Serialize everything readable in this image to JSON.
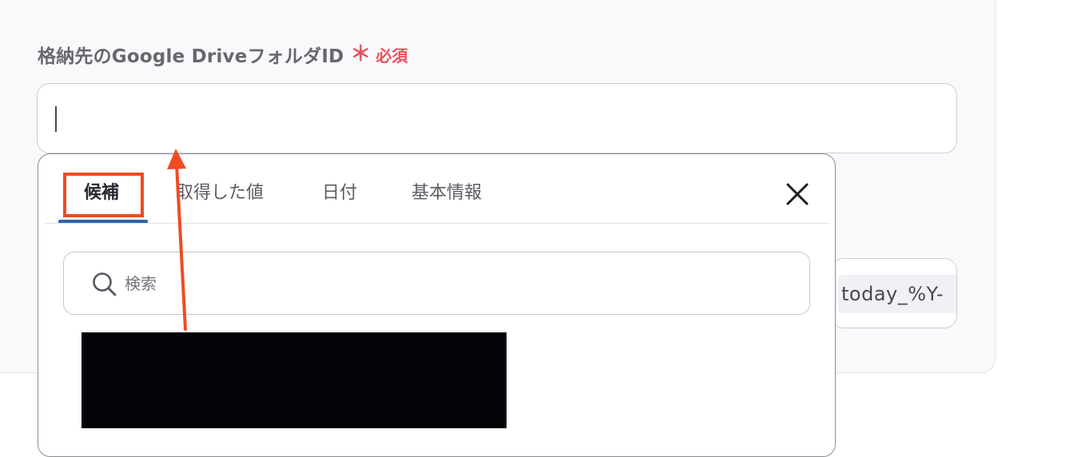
{
  "form": {
    "label": "格納先のGoogle DriveフォルダID",
    "required_mark": "＊",
    "required_text": "必須",
    "folder_id_value": "",
    "other_field_value": "today_%Y-"
  },
  "popup": {
    "tabs": [
      {
        "label": "候補",
        "active": true
      },
      {
        "label": "取得した値",
        "active": false
      },
      {
        "label": "日付",
        "active": false
      },
      {
        "label": "基本情報",
        "active": false
      }
    ],
    "close_label": "×",
    "search": {
      "placeholder": "検索",
      "value": ""
    }
  },
  "colors": {
    "required": "#e8525b",
    "annotation": "#ef4b22",
    "tab_underline": "#2f66a7"
  }
}
